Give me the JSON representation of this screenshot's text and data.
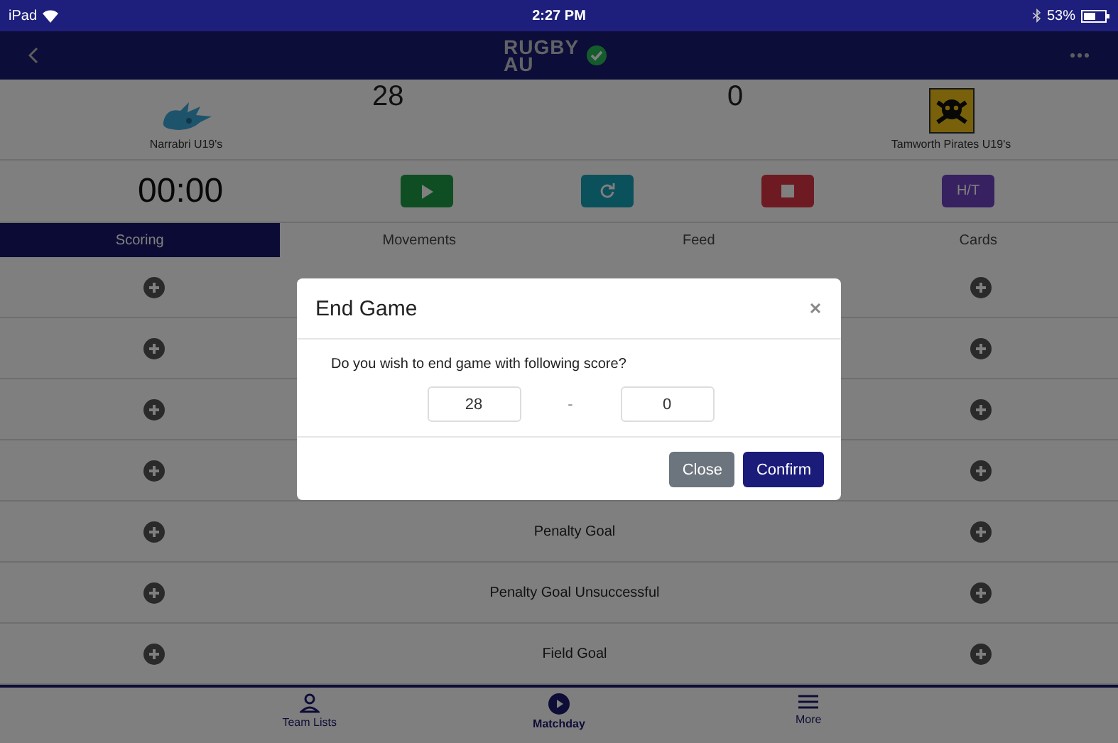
{
  "status_bar": {
    "device": "iPad",
    "time": "2:27 PM",
    "battery": "53%"
  },
  "header": {
    "logo_lines": [
      "RUGBY",
      "AU"
    ]
  },
  "teams": [
    {
      "name": "Narrabri U19's",
      "score": "28"
    },
    {
      "name": "Tamworth Pirates U19's",
      "score": "0"
    }
  ],
  "timer": "00:00",
  "controls": [
    {
      "kind": "play"
    },
    {
      "kind": "reset"
    },
    {
      "kind": "stop"
    },
    {
      "kind": "text",
      "label": "H/T"
    }
  ],
  "tabs": [
    {
      "label": "Scoring",
      "selected": true
    },
    {
      "label": "Movements",
      "selected": false
    },
    {
      "label": "Feed",
      "selected": false
    },
    {
      "label": "Cards",
      "selected": false
    }
  ],
  "rows": [
    {},
    {},
    {},
    {},
    {
      "label": "Penalty Goal"
    },
    {
      "label": "Penalty Goal Unsuccessful"
    },
    {
      "label": "Field Goal"
    }
  ],
  "bottom_nav": [
    {
      "label": "Team Lists",
      "selected": false
    },
    {
      "label": "Matchday",
      "selected": true
    },
    {
      "label": "More",
      "selected": false
    }
  ],
  "dialog": {
    "title": "End Game",
    "message": "Do you wish to end game with following score?",
    "home_score": "28",
    "separator": "-",
    "away_score": "0",
    "buttons": [
      {
        "label": "Close",
        "kind": "secondary"
      },
      {
        "label": "Confirm",
        "kind": "primary"
      }
    ]
  }
}
